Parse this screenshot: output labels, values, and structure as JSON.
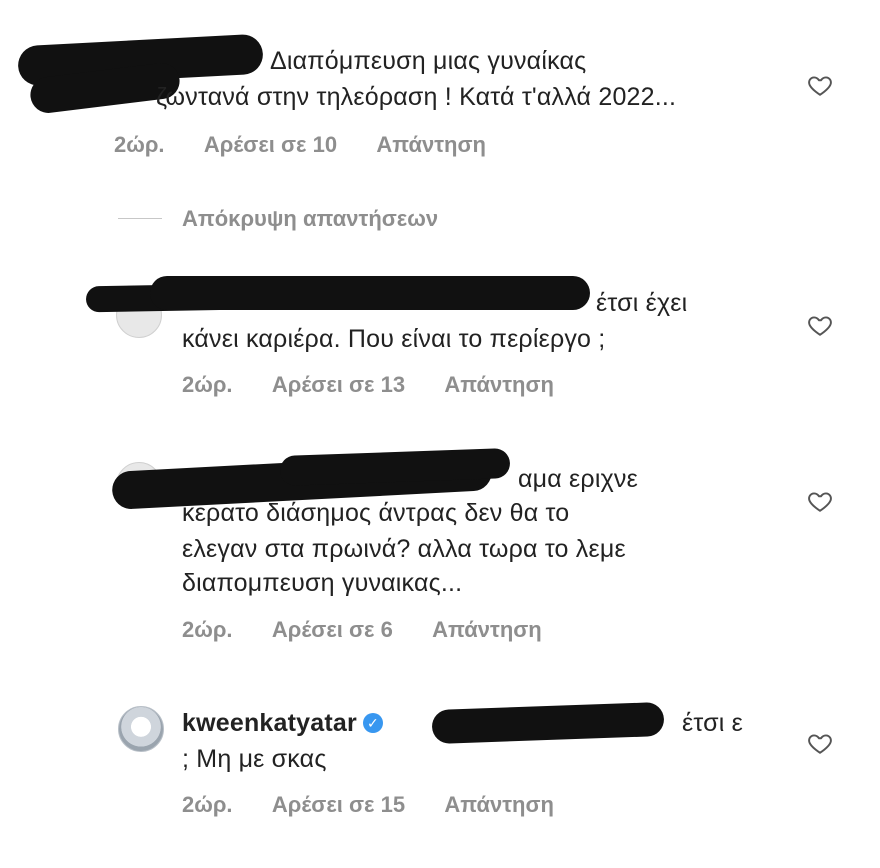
{
  "comments": [
    {
      "text_line1": "Διαπόμπευση μιας γυναίκας",
      "text_line2": "ζωντανά στην τηλεόραση ! Κατά τ'αλλά 2022...",
      "time": "2ώρ.",
      "likes": "Αρέσει σε 10",
      "reply": "Απάντηση"
    },
    {
      "text_line1": "έτσι έχει",
      "text_line2": "κάνει καριέρα. Που είναι το περίεργο ;",
      "time": "2ώρ.",
      "likes": "Αρέσει σε 13",
      "reply": "Απάντηση"
    },
    {
      "text_line1": "αμα εριχνε",
      "text_line2": "κερατο διάσημος άντρας δεν θα το",
      "text_line3": "ελεγαν στα πρωινά? αλλα τωρα το λεμε",
      "text_line4": "διαπομπευση γυναικας...",
      "time": "2ώρ.",
      "likes": "Αρέσει σε 6",
      "reply": "Απάντηση"
    },
    {
      "username": "kweenkatyatar",
      "text_line1": "έτσι ε",
      "text_line2": "; Μη με σκας",
      "time": "2ώρ.",
      "likes": "Αρέσει σε 15",
      "reply": "Απάντηση"
    }
  ],
  "hide_replies": "Απόκρυψη απαντήσεων",
  "icons": {
    "heart": "heart-outline-icon",
    "verified": "verified-badge-icon"
  },
  "colors": {
    "meta": "#8e8e8e",
    "verified": "#3897f0",
    "text": "#222222"
  }
}
